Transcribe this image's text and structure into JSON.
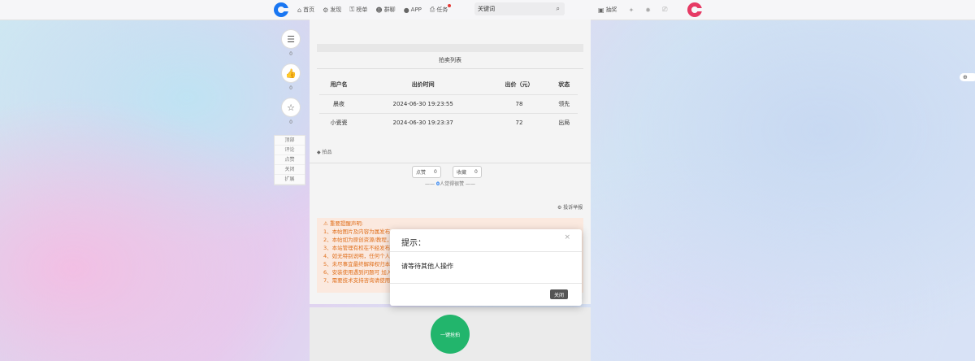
{
  "nav": {
    "items": [
      {
        "icon": "⌂",
        "label": "首页"
      },
      {
        "icon": "⚙",
        "label": "发现"
      },
      {
        "icon": "⚿",
        "label": "榜单"
      },
      {
        "icon": "☻",
        "label": "群聊"
      },
      {
        "icon": "●",
        "label": "APP"
      },
      {
        "icon": "⎙",
        "label": "任务"
      }
    ],
    "search_placeholder": "关键词",
    "search_icon": "⌕",
    "sign_icon": "▣",
    "sign_label": "抽奖"
  },
  "side": {
    "comment_count": "0",
    "like_count": "0",
    "fav_count": "0",
    "labels": [
      "顶部",
      "评论",
      "点赞",
      "关闭",
      "扩展"
    ]
  },
  "auction": {
    "title": "拍卖列表",
    "headers": [
      "用户名",
      "出价时间",
      "出价（元）",
      "状态"
    ],
    "rows": [
      [
        "晨夜",
        "2024-06-30 19:23:55",
        "78",
        "领先"
      ],
      [
        "小瓷瓷",
        "2024-06-30 19:23:37",
        "72",
        "出局"
      ]
    ]
  },
  "tag": "◆ 拍品",
  "votes": {
    "like": "点赞",
    "like_count": "0",
    "fav": "收藏",
    "fav_count": "0"
  },
  "reward": {
    "count": "0",
    "text": "人觉得很赞"
  },
  "report": "投诉举报",
  "notice": {
    "lines": [
      "⚠ 重要提醒声明:",
      "1、本帖图片及内容为属发布",
      "2、本帖如为原创资源/教程，",
      "3、本站管理有权在不经发布",
      "4、如无特别说明，任何个人",
      "5、未尽事宜最终解释权归本",
      "6、安装使用遇到问题可 加入",
      "7、需要技术支持咨询请使用"
    ]
  },
  "bid_button": "一键抢拍",
  "modal": {
    "title": "提示：",
    "message": "请等待其他人操作",
    "close_label": "关闭"
  }
}
